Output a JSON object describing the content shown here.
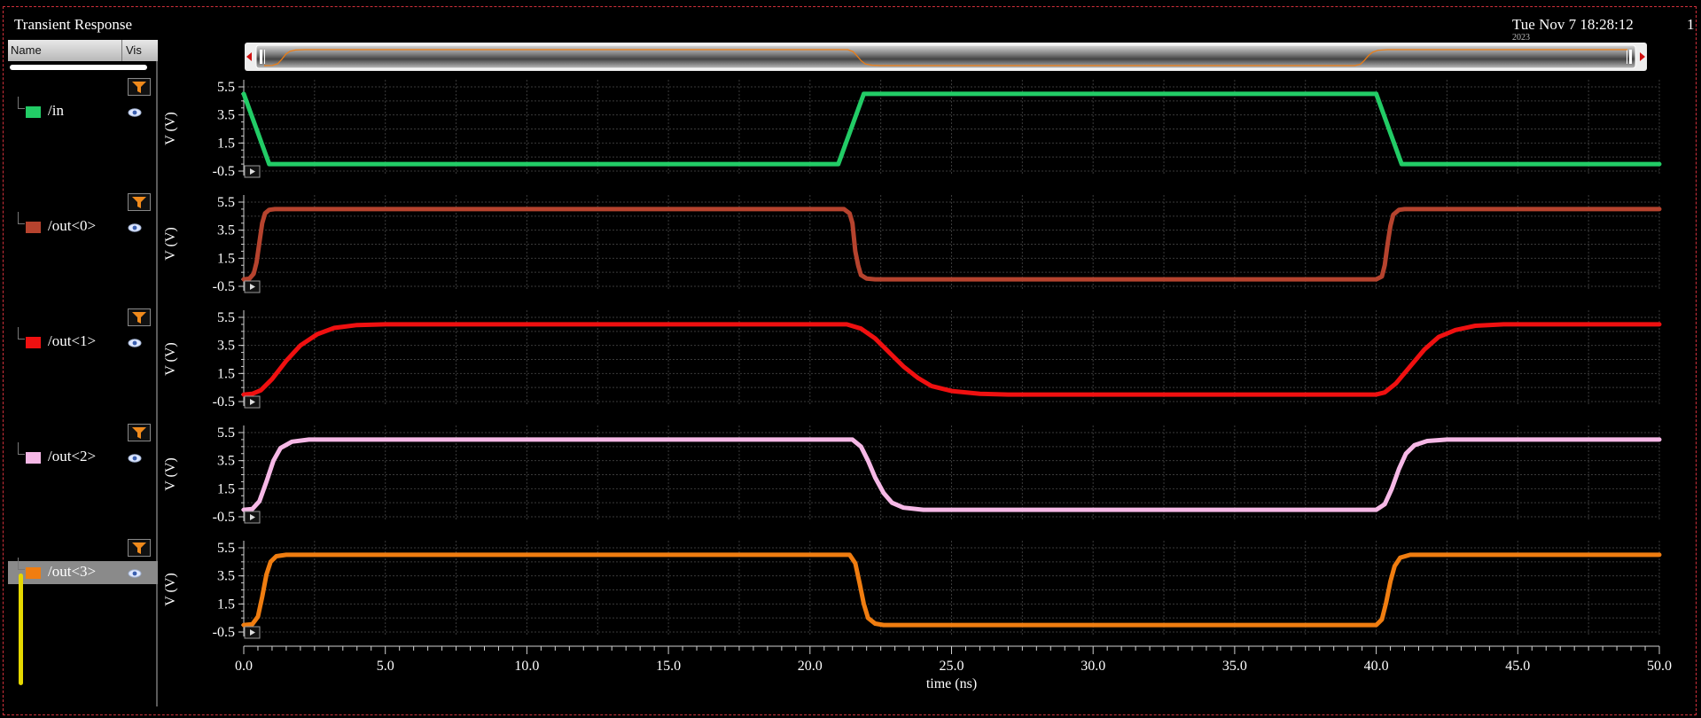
{
  "window": {
    "title": "Transient Response",
    "datetime": "Tue Nov 7 18:28:12",
    "datetime_line2": "2023",
    "page_number": "1"
  },
  "signal_list": {
    "columns": {
      "name": "Name",
      "vis": "Vis"
    },
    "signals": [
      {
        "name": "/in",
        "color": "#22cc66",
        "icon": "eye-icon",
        "selected": false
      },
      {
        "name": "/out<0>",
        "color": "#b6432e",
        "icon": "eye-icon",
        "selected": false
      },
      {
        "name": "/out<1>",
        "color": "#f01010",
        "icon": "eye-icon",
        "selected": false
      },
      {
        "name": "/out<2>",
        "color": "#f6b8e6",
        "icon": "eye-icon",
        "selected": false
      },
      {
        "name": "/out<3>",
        "color": "#f07d10",
        "icon": "eye-icon",
        "selected": true
      }
    ],
    "filter_icon": "filter-icon"
  },
  "chart_data": {
    "type": "line",
    "xlabel": "time (ns)",
    "xlim": [
      0,
      50
    ],
    "xticks": [
      "0.0",
      "5.0",
      "10.0",
      "15.0",
      "20.0",
      "25.0",
      "30.0",
      "35.0",
      "40.0",
      "45.0",
      "50.0"
    ],
    "grid": true,
    "strips": [
      {
        "name": "/in",
        "color": "#22cc66",
        "ylabel": "V (V)",
        "ylim": [
          -0.5,
          5.5
        ],
        "yticks": [
          "5.5",
          "3.5",
          "1.5",
          "-0.5"
        ],
        "points": [
          [
            0,
            5.0
          ],
          [
            0.9,
            0.0
          ],
          [
            21.0,
            0.0
          ],
          [
            21.9,
            5.0
          ],
          [
            40.0,
            5.0
          ],
          [
            40.9,
            0.0
          ],
          [
            50.0,
            0.0
          ]
        ]
      },
      {
        "name": "/out<0>",
        "color": "#b6432e",
        "ylabel": "V (V)",
        "ylim": [
          -0.5,
          5.5
        ],
        "yticks": [
          "5.5",
          "3.5",
          "1.5",
          "-0.5"
        ],
        "points": [
          [
            0,
            0.0
          ],
          [
            0.2,
            0.05
          ],
          [
            0.35,
            0.4
          ],
          [
            0.45,
            1.2
          ],
          [
            0.55,
            2.6
          ],
          [
            0.65,
            4.0
          ],
          [
            0.75,
            4.7
          ],
          [
            0.9,
            4.95
          ],
          [
            1.1,
            5.0
          ],
          [
            21.2,
            5.0
          ],
          [
            21.4,
            4.7
          ],
          [
            21.5,
            4.0
          ],
          [
            21.55,
            3.0
          ],
          [
            21.6,
            2.0
          ],
          [
            21.7,
            1.0
          ],
          [
            21.8,
            0.3
          ],
          [
            22.0,
            0.05
          ],
          [
            22.3,
            0.0
          ],
          [
            40.0,
            0.0
          ],
          [
            40.2,
            0.2
          ],
          [
            40.3,
            1.0
          ],
          [
            40.4,
            2.5
          ],
          [
            40.5,
            3.8
          ],
          [
            40.6,
            4.6
          ],
          [
            40.8,
            4.95
          ],
          [
            41.0,
            5.0
          ],
          [
            50.0,
            5.0
          ]
        ]
      },
      {
        "name": "/out<1>",
        "color": "#f01010",
        "ylabel": "V (V)",
        "ylim": [
          -0.5,
          5.5
        ],
        "yticks": [
          "5.5",
          "3.5",
          "1.5",
          "-0.5"
        ],
        "points": [
          [
            0,
            0.0
          ],
          [
            0.3,
            0.05
          ],
          [
            0.6,
            0.3
          ],
          [
            1.0,
            1.1
          ],
          [
            1.5,
            2.4
          ],
          [
            2.0,
            3.5
          ],
          [
            2.6,
            4.3
          ],
          [
            3.2,
            4.75
          ],
          [
            4.0,
            4.95
          ],
          [
            5.0,
            5.0
          ],
          [
            21.3,
            5.0
          ],
          [
            21.8,
            4.7
          ],
          [
            22.3,
            4.0
          ],
          [
            22.8,
            3.0
          ],
          [
            23.3,
            2.0
          ],
          [
            23.8,
            1.2
          ],
          [
            24.3,
            0.6
          ],
          [
            25.0,
            0.25
          ],
          [
            26.0,
            0.05
          ],
          [
            27.0,
            0.0
          ],
          [
            40.0,
            0.0
          ],
          [
            40.3,
            0.15
          ],
          [
            40.7,
            0.8
          ],
          [
            41.2,
            2.0
          ],
          [
            41.7,
            3.2
          ],
          [
            42.2,
            4.1
          ],
          [
            42.8,
            4.6
          ],
          [
            43.5,
            4.9
          ],
          [
            44.5,
            5.0
          ],
          [
            50.0,
            5.0
          ]
        ]
      },
      {
        "name": "/out<2>",
        "color": "#f6b8e6",
        "ylabel": "V (V)",
        "ylim": [
          -0.5,
          5.5
        ],
        "yticks": [
          "5.5",
          "3.5",
          "1.5",
          "-0.5"
        ],
        "points": [
          [
            0,
            0.0
          ],
          [
            0.3,
            0.05
          ],
          [
            0.55,
            0.6
          ],
          [
            0.8,
            2.0
          ],
          [
            1.05,
            3.5
          ],
          [
            1.3,
            4.4
          ],
          [
            1.7,
            4.85
          ],
          [
            2.3,
            5.0
          ],
          [
            21.5,
            5.0
          ],
          [
            21.8,
            4.5
          ],
          [
            22.05,
            3.5
          ],
          [
            22.3,
            2.3
          ],
          [
            22.6,
            1.2
          ],
          [
            22.9,
            0.5
          ],
          [
            23.3,
            0.15
          ],
          [
            24.0,
            0.0
          ],
          [
            40.0,
            0.0
          ],
          [
            40.3,
            0.4
          ],
          [
            40.55,
            1.5
          ],
          [
            40.8,
            2.9
          ],
          [
            41.05,
            4.0
          ],
          [
            41.35,
            4.6
          ],
          [
            41.8,
            4.9
          ],
          [
            42.5,
            5.0
          ],
          [
            50.0,
            5.0
          ]
        ]
      },
      {
        "name": "/out<3>",
        "color": "#f07d10",
        "ylabel": "V (V)",
        "ylim": [
          -0.5,
          5.5
        ],
        "yticks": [
          "5.5",
          "3.5",
          "1.5",
          "-0.5"
        ],
        "points": [
          [
            0,
            0.0
          ],
          [
            0.3,
            0.05
          ],
          [
            0.5,
            0.6
          ],
          [
            0.65,
            2.0
          ],
          [
            0.8,
            3.6
          ],
          [
            0.95,
            4.5
          ],
          [
            1.15,
            4.9
          ],
          [
            1.5,
            5.0
          ],
          [
            21.4,
            5.0
          ],
          [
            21.6,
            4.4
          ],
          [
            21.75,
            3.0
          ],
          [
            21.9,
            1.5
          ],
          [
            22.05,
            0.5
          ],
          [
            22.3,
            0.1
          ],
          [
            22.6,
            0.0
          ],
          [
            40.0,
            0.0
          ],
          [
            40.2,
            0.4
          ],
          [
            40.35,
            1.6
          ],
          [
            40.5,
            3.1
          ],
          [
            40.65,
            4.2
          ],
          [
            40.85,
            4.8
          ],
          [
            41.2,
            5.0
          ],
          [
            50.0,
            5.0
          ]
        ]
      }
    ]
  }
}
